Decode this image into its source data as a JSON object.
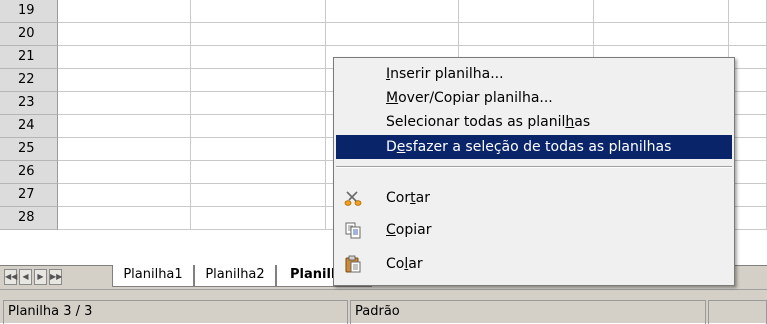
{
  "grid": {
    "row_numbers": [
      "19",
      "20",
      "21",
      "22",
      "23",
      "24",
      "25",
      "26",
      "27",
      "28"
    ]
  },
  "context_menu": {
    "items": [
      {
        "pre": "",
        "u": "I",
        "post": "nserir planilha...",
        "icon": null,
        "selected": false
      },
      {
        "pre": "",
        "u": "M",
        "post": "over/Copiar planilha...",
        "icon": null,
        "selected": false
      },
      {
        "pre": "Selecionar todas as planil",
        "u": "h",
        "post": "as",
        "icon": null,
        "selected": false
      },
      {
        "pre": "D",
        "u": "e",
        "post": "sfazer a seleção de todas as planilhas",
        "icon": null,
        "selected": true
      },
      {
        "pre": "Cor",
        "u": "t",
        "post": "ar",
        "icon": "scissors-icon",
        "selected": false
      },
      {
        "pre": "",
        "u": "C",
        "post": "opiar",
        "icon": "copy-icon",
        "selected": false
      },
      {
        "pre": "Co",
        "u": "l",
        "post": "ar",
        "icon": "paste-icon",
        "selected": false
      }
    ],
    "highlight_color": "#0a246a"
  },
  "tabbar": {
    "nav_buttons": [
      "first-sheet",
      "previous-sheet",
      "next-sheet",
      "last-sheet"
    ],
    "tabs": [
      {
        "label": "Planilha1",
        "active": false
      },
      {
        "label": "Planilha2",
        "active": false
      },
      {
        "label": "Planilha3",
        "active": true
      }
    ]
  },
  "statusbar": {
    "sheet_position": "Planilha 3 / 3",
    "page_style": "Padrão"
  }
}
